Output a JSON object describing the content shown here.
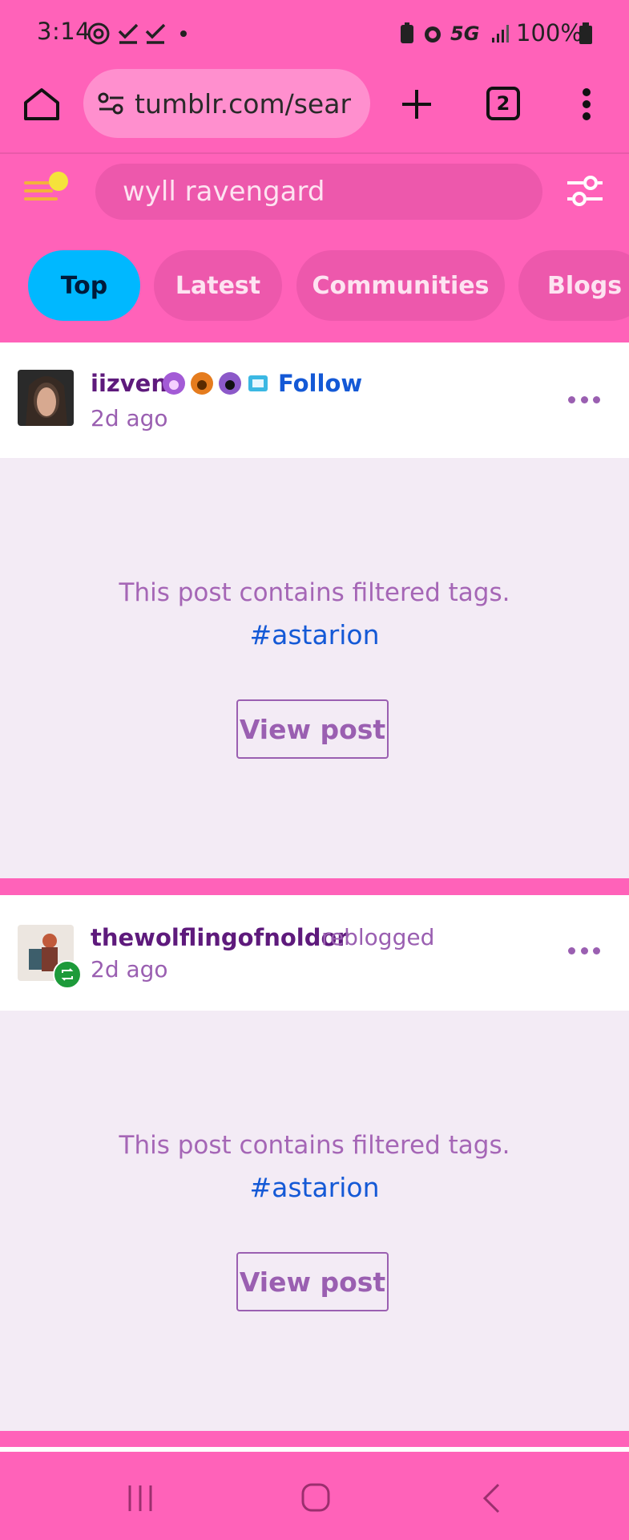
{
  "status_bar": {
    "time": "3:14",
    "network": "5G",
    "battery": "100%"
  },
  "browser": {
    "url": "tumblr.com/search",
    "tab_count": "2"
  },
  "search": {
    "query": "wyll ravengard"
  },
  "tabs": [
    {
      "label": "Top",
      "active": true
    },
    {
      "label": "Latest",
      "active": false
    },
    {
      "label": "Communities",
      "active": false
    },
    {
      "label": "Blogs",
      "active": false
    }
  ],
  "posts": [
    {
      "username": "iizven",
      "action": "",
      "follow_label": "Follow",
      "time_ago": "2d ago",
      "filtered_text": "This post contains filtered tags.",
      "tag": "#astarion",
      "view_label": "View post"
    },
    {
      "username": "thewolflingofnoldor",
      "action": "reblogged",
      "follow_label": "",
      "time_ago": "2d ago",
      "filtered_text": "This post contains filtered tags.",
      "tag": "#astarion",
      "view_label": "View post"
    }
  ],
  "colors": {
    "accent": "#ff62b9",
    "active_tab": "#00b8ff",
    "link": "#1459d6"
  }
}
